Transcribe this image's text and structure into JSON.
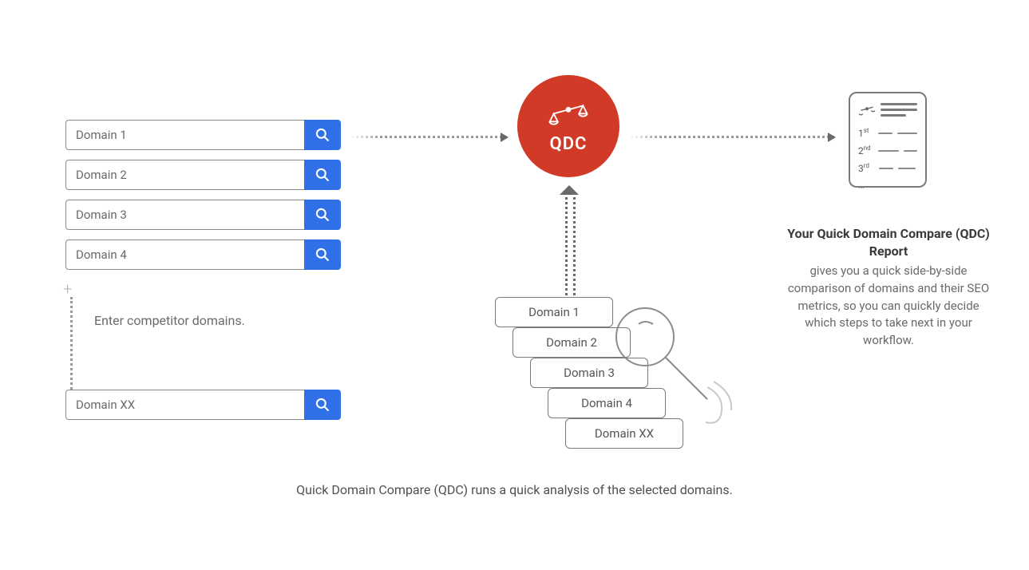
{
  "inputs": {
    "domains": [
      "Domain 1",
      "Domain 2",
      "Domain 3",
      "Domain 4"
    ],
    "domain_xx": "Domain XX",
    "instruction": "Enter competitor domains."
  },
  "qdc": {
    "label": "QDC"
  },
  "stack": {
    "cards": [
      "Domain 1",
      "Domain 2",
      "Domain 3",
      "Domain 4",
      "Domain XX"
    ]
  },
  "caption": "Quick Domain Compare (QDC) runs a quick analysis of the selected domains.",
  "report": {
    "ranks": [
      "1st",
      "2nd",
      "3rd"
    ],
    "title": "Your Quick Domain Compare (QDC) Report",
    "description": "gives you a quick side-by-side comparison of domains and their SEO metrics, so you can quickly decide which steps to take next in your workflow."
  }
}
